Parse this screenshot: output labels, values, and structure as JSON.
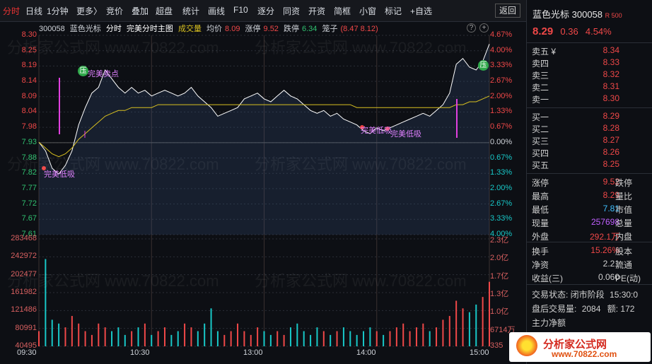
{
  "toolbar": {
    "items": [
      "分时",
      "日线",
      "1分钟",
      "更多〉",
      "竞价",
      "叠加",
      "超盘",
      "统计",
      "画线",
      "F10",
      "逐分",
      "同资",
      "开资",
      "简框",
      "小窗",
      "标记",
      "+自选"
    ],
    "return_label": "返回"
  },
  "info": {
    "code": "300058",
    "name": "蓝色光标",
    "chart_name": "分时",
    "indicator": "完美分时主图",
    "volume_label": "成交量",
    "avg_label": "均价",
    "avg_value": "8.09",
    "limit_up_label": "涨停",
    "limit_up_value": "9.52",
    "limit_down_label": "跌停",
    "limit_down_value": "6.34",
    "cage_label": "笼子",
    "cage_value": "(8.47 8.12)"
  },
  "price_axis": [
    "8.30",
    "8.25",
    "8.19",
    "8.14",
    "8.09",
    "8.04",
    "7.98",
    "7.93",
    "7.88",
    "7.82",
    "7.77",
    "7.72",
    "7.67",
    "7.61"
  ],
  "pct_axis": [
    "4.67%",
    "4.00%",
    "3.33%",
    "2.67%",
    "2.00%",
    "1.33%",
    "0.67%",
    "0.00%",
    "0.67%",
    "1.33%",
    "2.00%",
    "2.67%",
    "3.33%",
    "4.00%"
  ],
  "vol_axis_left": [
    "283468",
    "242972",
    "202477",
    "161982",
    "121486",
    "80991",
    "40495"
  ],
  "vol_axis_right": [
    "2.3亿",
    "2.0亿",
    "1.7亿",
    "1.3亿",
    "1.0亿",
    "6714万",
    "335"
  ],
  "time_axis": [
    "09:30",
    "10:30",
    "13:00",
    "14:00",
    "15:00"
  ],
  "annotations": {
    "sell_point": "完美卖点",
    "low_buy": "完美低吸",
    "press_icon": "压"
  },
  "chart_data": {
    "type": "line",
    "title": "",
    "ylim": [
      7.61,
      8.3
    ],
    "series": [
      {
        "name": "price",
        "values": [
          7.93,
          7.9,
          7.84,
          7.82,
          7.85,
          7.9,
          7.99,
          8.05,
          8.1,
          8.12,
          8.18,
          8.15,
          8.12,
          8.1,
          8.12,
          8.1,
          8.11,
          8.09,
          8.1,
          8.11,
          8.1,
          8.09,
          8.1,
          8.12,
          8.09,
          8.07,
          8.05,
          8.02,
          8.03,
          8.04,
          8.05,
          8.08,
          8.09,
          8.1,
          8.08,
          8.07,
          8.09,
          8.11,
          8.09,
          8.08,
          8.06,
          8.04,
          8.03,
          8.04,
          8.02,
          8.03,
          8.01,
          8.0,
          7.99,
          7.97,
          7.96,
          7.98,
          7.97,
          7.98,
          7.99,
          8.0,
          8.01,
          8.02,
          8.03,
          8.02,
          8.04,
          8.06,
          8.1,
          8.2,
          8.22,
          8.19,
          8.18,
          8.21,
          8.27
        ]
      },
      {
        "name": "均价",
        "values": [
          7.93,
          7.91,
          7.89,
          7.88,
          7.89,
          7.91,
          7.94,
          7.96,
          7.98,
          8.0,
          8.02,
          8.03,
          8.04,
          8.04,
          8.05,
          8.05,
          8.05,
          8.05,
          8.06,
          8.06,
          8.06,
          8.06,
          8.06,
          8.06,
          8.06,
          8.06,
          8.06,
          8.06,
          8.06,
          8.06,
          8.06,
          8.06,
          8.06,
          8.06,
          8.06,
          8.06,
          8.06,
          8.06,
          8.06,
          8.06,
          8.06,
          8.06,
          8.06,
          8.06,
          8.06,
          8.06,
          8.06,
          8.06,
          8.05,
          8.05,
          8.05,
          8.05,
          8.05,
          8.05,
          8.05,
          8.05,
          8.05,
          8.05,
          8.05,
          8.05,
          8.05,
          8.05,
          8.05,
          8.06,
          8.06,
          8.07,
          8.07,
          8.08,
          8.09
        ]
      }
    ],
    "volume": [
      40,
      230,
      70,
      60,
      50,
      80,
      60,
      40,
      30,
      60,
      50,
      40,
      50,
      30,
      40,
      50,
      60,
      30,
      40,
      50,
      30,
      40,
      60,
      50,
      40,
      60,
      100,
      40,
      30,
      40,
      60,
      40,
      30,
      50,
      40,
      30,
      40,
      30,
      50,
      60,
      40,
      30,
      50,
      40,
      30,
      40,
      50,
      40,
      30,
      40,
      50,
      40,
      30,
      40,
      50,
      60,
      40,
      50,
      60,
      40,
      50,
      70,
      80,
      120,
      100,
      90,
      110,
      130,
      170
    ]
  },
  "side": {
    "name": "蓝色光标",
    "code": "300058",
    "flag": "R 500",
    "price": "8.29",
    "change": "0.36",
    "change_pct": "4.54%",
    "sells": [
      {
        "label": "卖五 ¥",
        "price": "8.34"
      },
      {
        "label": "卖四",
        "price": "8.33"
      },
      {
        "label": "卖三",
        "price": "8.32"
      },
      {
        "label": "卖二",
        "price": "8.31"
      },
      {
        "label": "卖一",
        "price": "8.30"
      }
    ],
    "buys": [
      {
        "label": "买一",
        "price": "8.29"
      },
      {
        "label": "买二",
        "price": "8.28"
      },
      {
        "label": "买三",
        "price": "8.27"
      },
      {
        "label": "买四",
        "price": "8.26"
      },
      {
        "label": "买五",
        "price": "8.25"
      }
    ],
    "stats": [
      {
        "label": "涨停",
        "value": "9.52",
        "label2": "跌停"
      },
      {
        "label": "最高",
        "value": "8.29",
        "label2": "量比"
      },
      {
        "label": "最低",
        "value": "7.81",
        "label2": "市值"
      },
      {
        "label": "现量",
        "value": "257698",
        "label2": "总量"
      },
      {
        "label": "外盘",
        "value": "292.1万",
        "label2": "内盘"
      }
    ],
    "stats2": [
      {
        "label": "换手",
        "value": "15.26%",
        "label2": "股本"
      },
      {
        "label": "净资",
        "value": "2.21",
        "label2": "流通"
      },
      {
        "label": "收益(三)",
        "value": "0.060",
        "label2": "PE(动)"
      }
    ],
    "status_label": "交易状态: 闭市阶段",
    "status_time": "15:30:0",
    "after_label": "盘后交易量:",
    "after_value": "2084",
    "amount_label": "额:",
    "amount_value": "172",
    "main_flow_label": "主力净额"
  },
  "watermark": "分析家公式网 www.70822.com",
  "logo": {
    "title": "分析家公式网",
    "url": "www.70822.com"
  },
  "colors": {
    "up": "#f04848",
    "down": "#30c070",
    "avg_line": "#d8c020",
    "price_line": "#ffffff",
    "cyan": "#18c8c8",
    "magenta": "#e040e0"
  }
}
